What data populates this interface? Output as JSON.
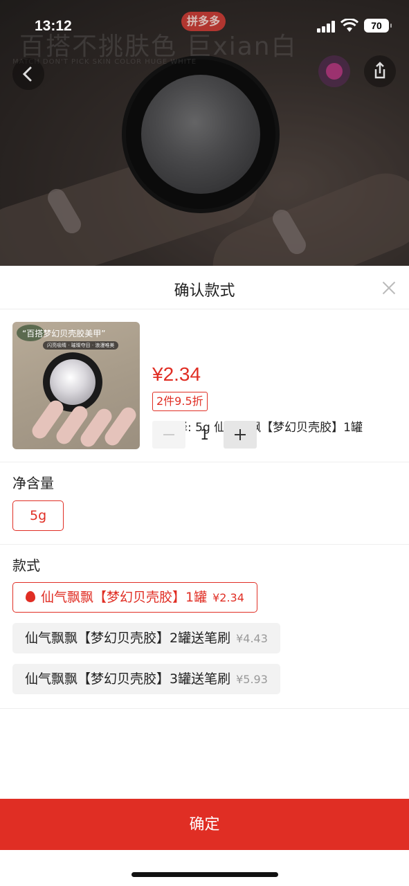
{
  "status_bar": {
    "time": "13:12",
    "battery": "70"
  },
  "backdrop": {
    "logo": "拼多多",
    "slogan": "百搭不挑肤色 巨xian白",
    "slogan_sub": "MATCH DON'T PICK SKIN COLOR HUGE WHITE"
  },
  "sheet": {
    "title": "确认款式"
  },
  "product": {
    "thumb_banner": "“百搭梦幻贝壳胶美甲”",
    "thumb_sub": "闪亮吸睛 · 璀璨夺目 · 浪漫唯美",
    "price": "¥2.34",
    "discount": "2件9.5折",
    "selected": "已选择: 5g 仙气飘飘【梦幻贝壳胶】1罐",
    "quantity": "1"
  },
  "net_content": {
    "title": "净含量",
    "options": [
      {
        "label": "5g",
        "selected": true
      }
    ]
  },
  "style": {
    "title": "款式",
    "options": [
      {
        "label": "仙气飘飘【梦幻贝壳胶】1罐",
        "price": "¥2.34",
        "selected": true,
        "icon": "fire-icon"
      },
      {
        "label": "仙气飘飘【梦幻贝壳胶】2罐送笔刷",
        "price": "¥4.43",
        "selected": false
      },
      {
        "label": "仙气飘飘【梦幻贝壳胶】3罐送笔刷",
        "price": "¥5.93",
        "selected": false
      }
    ]
  },
  "footer": {
    "confirm_label": "确定"
  },
  "colors": {
    "accent": "#e02e24"
  }
}
